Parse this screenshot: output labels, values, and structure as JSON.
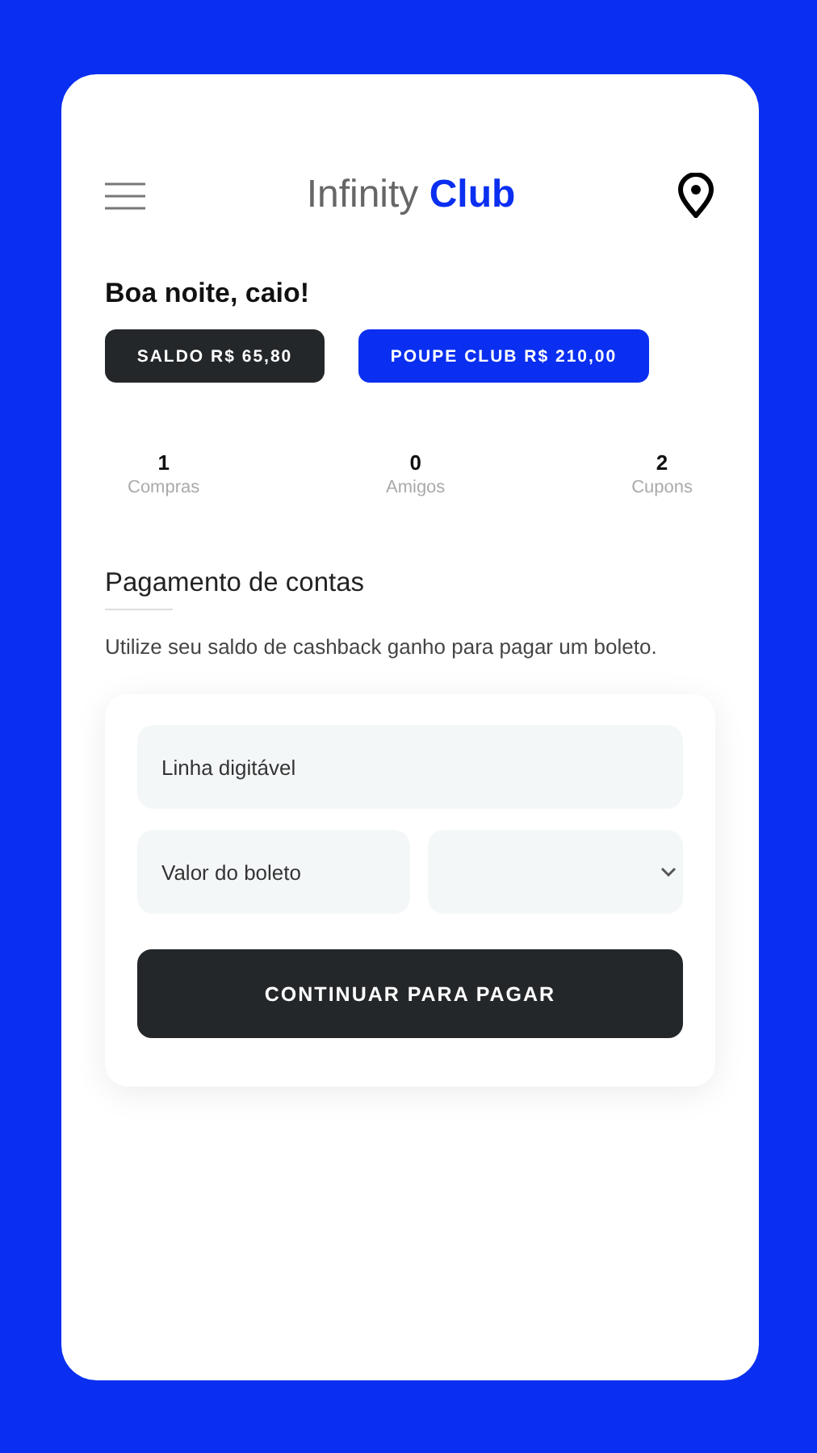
{
  "header": {
    "title": "Infinity **Club**"
  },
  "greeting": "Boa noite, caio!",
  "balances": [
    {
      "label": "SALDO R$ 65,80",
      "kind": "dark"
    },
    {
      "label": "POUPE CLUB R$ 210,00",
      "kind": "primary"
    }
  ],
  "stats": [
    {
      "value": "1",
      "label": "Compras"
    },
    {
      "value": "0",
      "label": "Amigos"
    },
    {
      "value": "2",
      "label": "Cupons"
    }
  ],
  "section": {
    "title": "Pagamento de contas",
    "description": "Utilize seu saldo de cashback ganho para pagar um boleto."
  },
  "form": {
    "barcode_field": {
      "placeholder": "Linha digitável"
    },
    "amount_field": {
      "placeholder": "Valor do boleto"
    },
    "submit": "CONTINUAR PARA PAGAR"
  }
}
